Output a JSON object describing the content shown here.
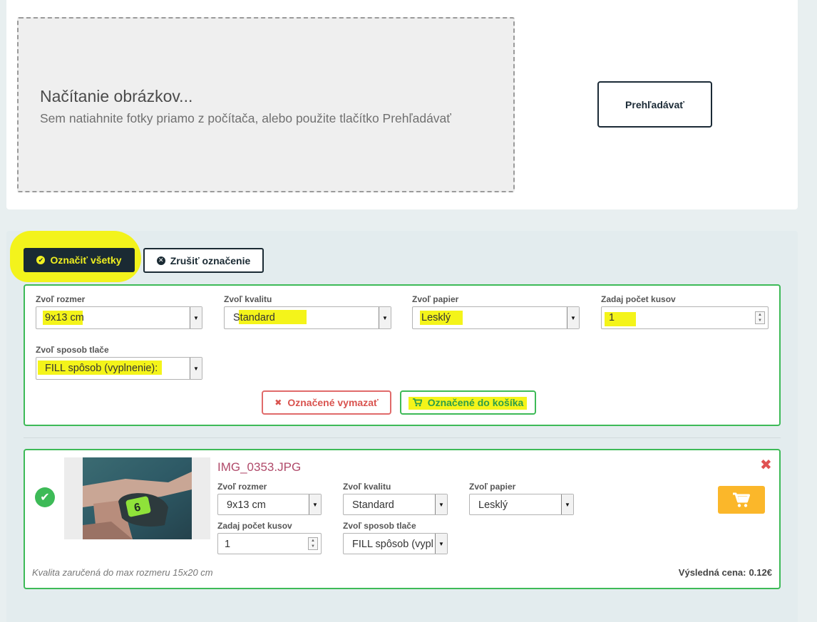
{
  "upload": {
    "title": "Načítanie obrázkov...",
    "subtitle": "Sem natiahnite fotky priamo z počítača, alebo použite tlačítko Prehľadávať",
    "browse_label": "Prehľadávať"
  },
  "bulk": {
    "mark_all_label": "Označiť všetky",
    "unmark_label": "Zrušiť označenie",
    "size_label": "Zvoľ rozmer",
    "size_value": "9x13 cm",
    "quality_label": "Zvoľ kvalitu",
    "quality_value": "Standard",
    "paper_label": "Zvoľ papier",
    "paper_value": "Lesklý",
    "count_label": "Zadaj počet kusov",
    "count_value": "1",
    "method_label": "Zvoľ sposob tlače",
    "method_value": "FILL spôsob (vyplnenie):",
    "delete_label": "Označené vymazať",
    "to_cart_label": "Označené do košíka"
  },
  "item": {
    "filename": "IMG_0353.JPG",
    "size_label": "Zvoľ rozmer",
    "size_value": "9x13 cm",
    "quality_label": "Zvoľ kvalitu",
    "quality_value": "Standard",
    "paper_label": "Zvoľ papier",
    "paper_value": "Lesklý",
    "count_label": "Zadaj počet kusov",
    "count_value": "1",
    "method_label": "Zvoľ sposob tlače",
    "method_value": "FILL spôsob (vypl",
    "quality_note": "Kvalita zaručená do max rozmeru 15x20 cm",
    "price_label": "Výsledná cena:",
    "price_value": "0.12€"
  },
  "colors": {
    "accent_green": "#3dba57",
    "dark_navy": "#1a2a33",
    "highlight_yellow": "#f4f41a",
    "cart_orange": "#fbb72a",
    "danger_red": "#d9534f"
  }
}
